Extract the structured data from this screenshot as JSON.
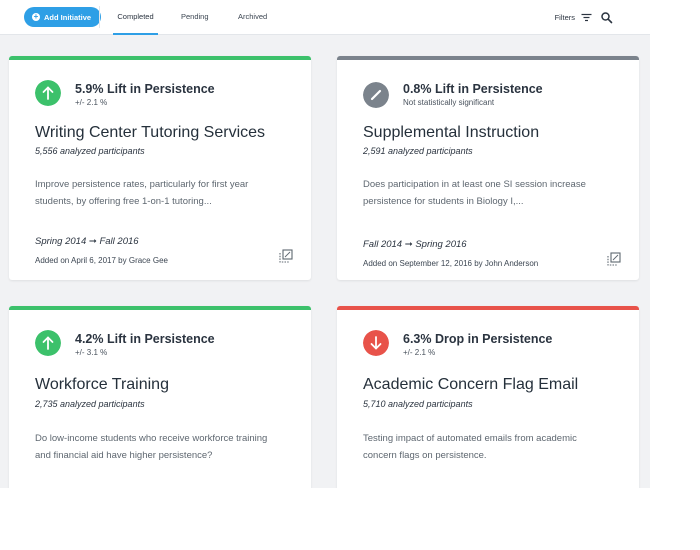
{
  "toolbar": {
    "add_label": "Add Initiative",
    "tabs": [
      {
        "label": "Completed",
        "active": true
      },
      {
        "label": "Pending",
        "active": false
      },
      {
        "label": "Archived",
        "active": false
      }
    ],
    "filters_label": "Filters",
    "filters_icon": "filter-lines-icon",
    "search_icon": "search-icon"
  },
  "colors": {
    "accent": "#2e9fe6",
    "lift": "#3cc16b",
    "neutral": "#7b838c",
    "drop": "#e8534a"
  },
  "cards": [
    {
      "status": "lift",
      "icon": "arrow-up-icon",
      "stat": "5.9% Lift in Persistence",
      "stat_sub": "+/- 2.1 %",
      "title": "Writing Center Tutoring Services",
      "participants": "5,556 analyzed participants",
      "description": "Improve persistence rates, particularly for first year students, by offering free 1-on-1 tutoring...",
      "dates": "Spring 2014 ➞ Fall 2016",
      "added": "Added on April 6, 2017 by Grace Gee"
    },
    {
      "status": "neutral",
      "icon": "slash-icon",
      "stat": "0.8% Lift in Persistence",
      "stat_sub": "Not statistically significant",
      "title": "Supplemental Instruction",
      "participants": "2,591 analyzed participants",
      "description": "Does participation in at least one SI session increase persistence for students in Biology I,...",
      "dates": "Fall 2014 ➞ Spring 2016",
      "added": "Added on September 12, 2016 by John Anderson"
    },
    {
      "status": "lift",
      "icon": "arrow-up-icon",
      "stat": "4.2% Lift in Persistence",
      "stat_sub": "+/- 3.1 %",
      "title": "Workforce Training",
      "participants": "2,735 analyzed participants",
      "description": "Do low-income students who receive workforce training and financial aid have higher persistence?",
      "dates": "",
      "added": ""
    },
    {
      "status": "drop",
      "icon": "arrow-down-icon",
      "stat": "6.3% Drop in Persistence",
      "stat_sub": "+/- 2.1 %",
      "title": "Academic Concern Flag Email",
      "participants": "5,710 analyzed participants",
      "description": "Testing impact of automated emails from academic concern flags on persistence.",
      "dates": "",
      "added": ""
    }
  ]
}
